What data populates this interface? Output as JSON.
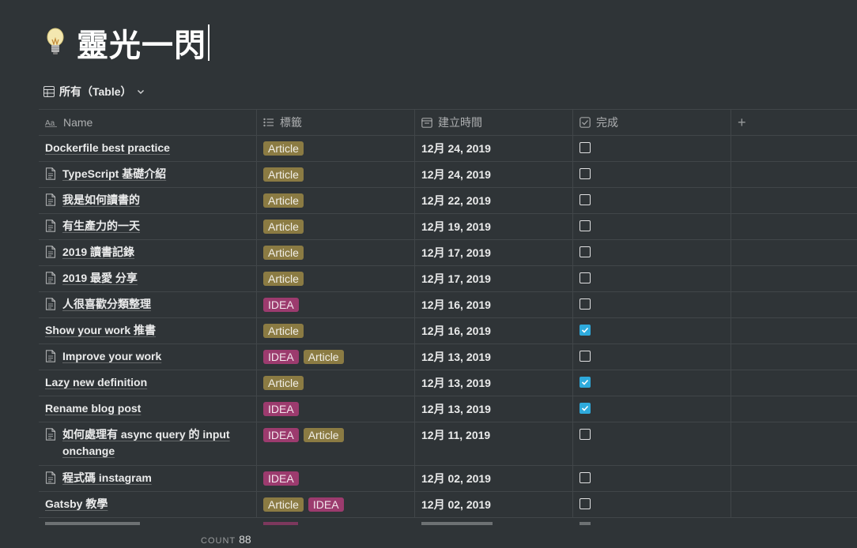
{
  "page": {
    "title": "靈光一閃",
    "icon": "lightbulb-icon"
  },
  "view": {
    "label": "所有（Table）"
  },
  "columns": {
    "name": "Name",
    "tags": "標籤",
    "created": "建立時間",
    "done": "完成"
  },
  "rows": [
    {
      "name": "Dockerfile best practice",
      "doc": false,
      "tags": [
        "Article"
      ],
      "date": "12月 24, 2019",
      "done": false
    },
    {
      "name": "TypeScript 基礎介紹",
      "doc": true,
      "tags": [
        "Article"
      ],
      "date": "12月 24, 2019",
      "done": false
    },
    {
      "name": "我是如何讀書的",
      "doc": true,
      "tags": [
        "Article"
      ],
      "date": "12月 22, 2019",
      "done": false
    },
    {
      "name": "有生產力的一天",
      "doc": true,
      "tags": [
        "Article"
      ],
      "date": "12月 19, 2019",
      "done": false
    },
    {
      "name": "2019 讀書記錄",
      "doc": true,
      "tags": [
        "Article"
      ],
      "date": "12月 17, 2019",
      "done": false
    },
    {
      "name": "2019 最愛 分享",
      "doc": true,
      "tags": [
        "Article"
      ],
      "date": "12月 17, 2019",
      "done": false
    },
    {
      "name": "人很喜歡分類整理",
      "doc": true,
      "tags": [
        "IDEA"
      ],
      "date": "12月 16, 2019",
      "done": false
    },
    {
      "name": "Show your work 推書",
      "doc": false,
      "tags": [
        "Article"
      ],
      "date": "12月 16, 2019",
      "done": true
    },
    {
      "name": "Improve your work",
      "doc": true,
      "tags": [
        "IDEA",
        "Article"
      ],
      "date": "12月 13, 2019",
      "done": false
    },
    {
      "name": "Lazy new definition",
      "doc": false,
      "tags": [
        "Article"
      ],
      "date": "12月 13, 2019",
      "done": true
    },
    {
      "name": "Rename blog post",
      "doc": false,
      "tags": [
        "IDEA"
      ],
      "date": "12月 13, 2019",
      "done": true
    },
    {
      "name": "如何處理有 async query 的 input onchange",
      "doc": true,
      "tags": [
        "IDEA",
        "Article"
      ],
      "date": "12月 11, 2019",
      "done": false
    },
    {
      "name": "程式碼 instagram",
      "doc": true,
      "tags": [
        "IDEA"
      ],
      "date": "12月 02, 2019",
      "done": false
    },
    {
      "name": "Gatsby 教學",
      "doc": false,
      "tags": [
        "Article",
        "IDEA"
      ],
      "date": "12月 02, 2019",
      "done": false
    }
  ],
  "footer": {
    "count_label": "COUNT",
    "count_value": "88"
  },
  "colors": {
    "background": "#2f3437",
    "article_tag": "#8b7b43",
    "idea_tag": "#9c3b6e",
    "checkbox_checked": "#2eaadc"
  }
}
